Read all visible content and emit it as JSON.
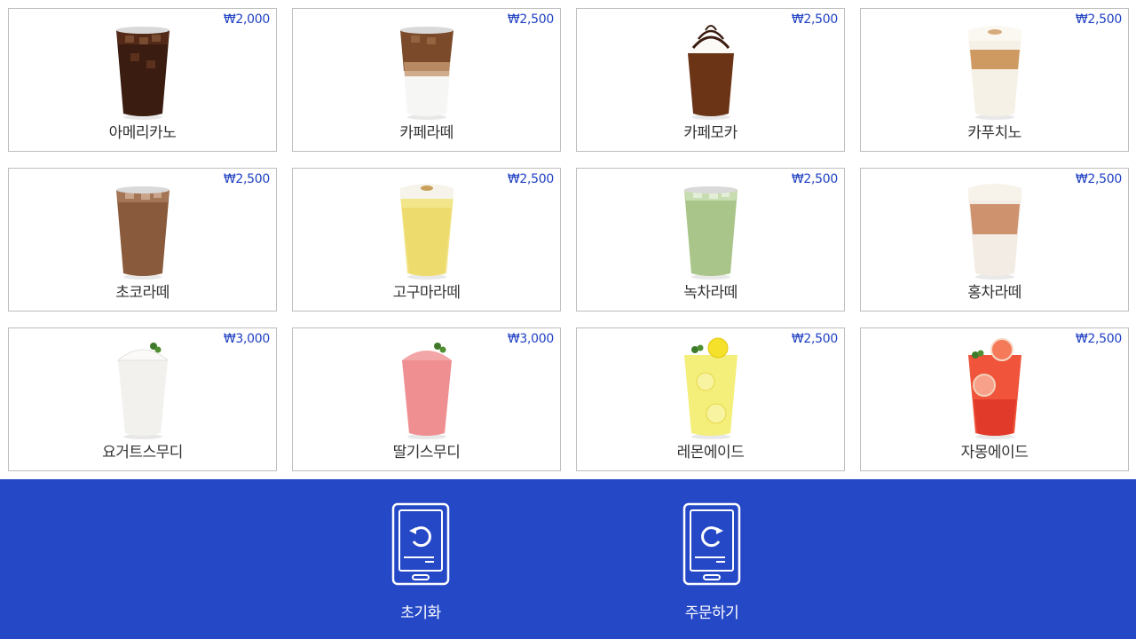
{
  "menu": [
    {
      "name": "아메리카노",
      "price": "₩2,000",
      "drink": "americano"
    },
    {
      "name": "카페라떼",
      "price": "₩2,500",
      "drink": "latte"
    },
    {
      "name": "카페모카",
      "price": "₩2,500",
      "drink": "mocha"
    },
    {
      "name": "카푸치노",
      "price": "₩2,500",
      "drink": "cappuccino"
    },
    {
      "name": "초코라떼",
      "price": "₩2,500",
      "drink": "choco-latte"
    },
    {
      "name": "고구마라떼",
      "price": "₩2,500",
      "drink": "sweet-potato-latte"
    },
    {
      "name": "녹차라떼",
      "price": "₩2,500",
      "drink": "green-tea-latte"
    },
    {
      "name": "홍차라떼",
      "price": "₩2,500",
      "drink": "black-tea-latte"
    },
    {
      "name": "요거트스무디",
      "price": "₩3,000",
      "drink": "yogurt-smoothie"
    },
    {
      "name": "딸기스무디",
      "price": "₩3,000",
      "drink": "strawberry-smoothie"
    },
    {
      "name": "레몬에이드",
      "price": "₩2,500",
      "drink": "lemonade"
    },
    {
      "name": "자몽에이드",
      "price": "₩2,500",
      "drink": "grapefruit-ade"
    }
  ],
  "footer": {
    "reset_label": "초기화",
    "order_label": "주문하기",
    "reset_icon": "tablet-reset-icon",
    "order_icon": "tablet-refresh-icon"
  },
  "colors": {
    "accent": "#2548c7",
    "price": "#1f3fc2",
    "card_border": "#bdbdbd"
  }
}
